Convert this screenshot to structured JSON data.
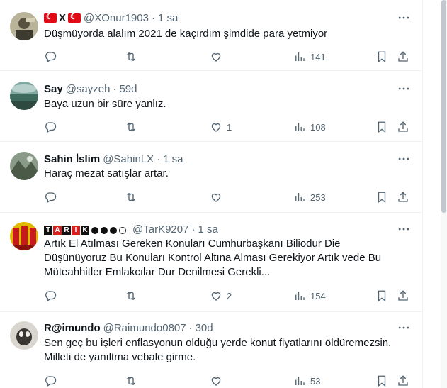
{
  "tweets": [
    {
      "name": "XX",
      "handle": "@XOnur1903",
      "time": "1 sa",
      "text": "Düşmüyorda alalım 2021 de kaçırdım şimdide para yetmiyor",
      "reply_count": "",
      "retweet_count": "",
      "like_count": "",
      "view_count": "141"
    },
    {
      "name": "Say",
      "handle": "@sayzeh",
      "time": "59d",
      "text": "Baya uzun bir süre yanlız.",
      "reply_count": "",
      "retweet_count": "",
      "like_count": "1",
      "view_count": "108"
    },
    {
      "name": "Sahin İslim",
      "handle": "@SahinLX",
      "time": "1 sa",
      "text": "Haraç mezat satışlar artar.",
      "reply_count": "",
      "retweet_count": "",
      "like_count": "",
      "view_count": "253"
    },
    {
      "name": "TARIK",
      "handle": "@TarK9207",
      "time": "1 sa",
      "text_lines": [
        "Artık El Atılması Gereken Konuları Cumhurbaşkanı Biliodur Die",
        "Düşünüyoruz Bu Konuları Kontrol Altına Alması Gerekiyor Artık vede Bu",
        "Müteahhitler Emlakcılar Dur Denilmesi Gerekli..."
      ],
      "reply_count": "",
      "retweet_count": "",
      "like_count": "2",
      "view_count": "154"
    },
    {
      "name": "R@imundo",
      "handle": "@Raimundo0807",
      "time": "30d",
      "text_lines": [
        "Sen geç bu işleri enflasyonun olduğu yerde konut fiyatlarını öldüremezsin.",
        "Milleti de yanıltma vebale girme."
      ],
      "reply_count": "",
      "retweet_count": "",
      "like_count": "",
      "view_count": "53"
    }
  ],
  "tark_letters": [
    "T",
    "A",
    "R",
    "I",
    "K"
  ],
  "colors": {
    "text": "#0f1419",
    "secondary": "#536471",
    "border": "#eff3f4",
    "flag_red": "#e30a17"
  },
  "icons": [
    "reply-icon",
    "retweet-icon",
    "like-icon",
    "views-icon",
    "bookmark-icon",
    "share-icon",
    "more-icon"
  ]
}
